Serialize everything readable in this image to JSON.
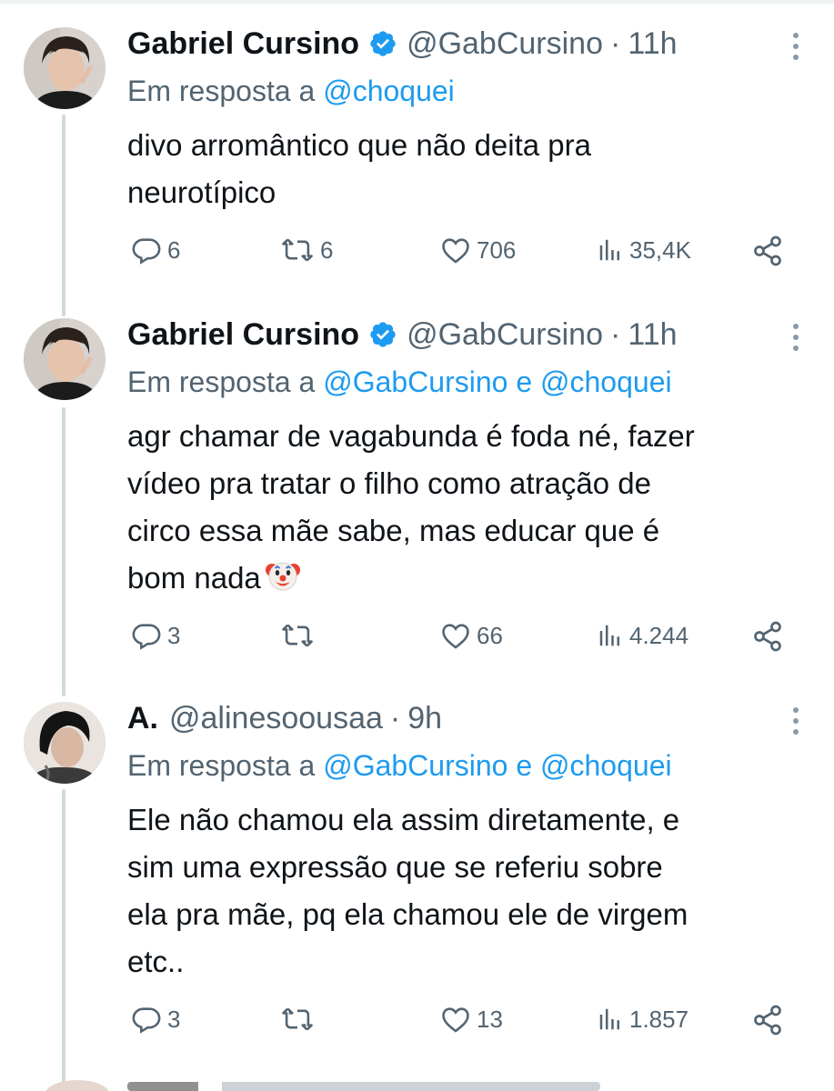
{
  "tweets": [
    {
      "name": "Gabriel Cursino",
      "verified": true,
      "handle": "@GabCursino",
      "separator": "·",
      "time": "11h",
      "reply_prefix": "Em resposta a",
      "reply_mention_1": "@choquei",
      "reply_and": "",
      "reply_mention_2": "",
      "text_lines": [
        "divo arromântico que não deita pra",
        "neurotípico"
      ],
      "stats": {
        "replies": "6",
        "retweets": "6",
        "likes": "706",
        "views": "35,4K"
      }
    },
    {
      "name": "Gabriel Cursino",
      "verified": true,
      "handle": "@GabCursino",
      "separator": "·",
      "time": "11h",
      "reply_prefix": "Em resposta a",
      "reply_mention_1": "@GabCursino",
      "reply_and": "e",
      "reply_mention_2": "@choquei",
      "text_lines": [
        "agr chamar de vagabunda é foda né, fazer",
        "vídeo pra tratar o filho como atração de",
        "circo essa mãe sabe, mas educar que é",
        "bom nada"
      ],
      "emoji": "clown-face",
      "stats": {
        "replies": "3",
        "retweets": "",
        "likes": "66",
        "views": "4.244"
      }
    },
    {
      "name": "A.",
      "verified": false,
      "handle": "@alinesoousaa",
      "separator": "·",
      "time": "9h",
      "reply_prefix": "Em resposta a",
      "reply_mention_1": "@GabCursino",
      "reply_and": "e",
      "reply_mention_2": "@choquei",
      "text_lines": [
        "Ele não chamou ela assim diretamente, e",
        "sim uma expressão que se referiu sobre",
        "ela pra mãe, pq ela chamou ele de virgem",
        "etc.."
      ],
      "stats": {
        "replies": "3",
        "retweets": "",
        "likes": "13",
        "views": "1.857"
      }
    }
  ],
  "icons": {
    "reply": "reply-icon",
    "retweet": "retweet-icon",
    "like": "heart-icon",
    "views": "views-icon",
    "share": "share-icon",
    "verified": "verified-badge-icon",
    "more": "more-options-icon"
  },
  "colors": {
    "text": "#0f1419",
    "secondary": "#536471",
    "link": "#1d9bf0",
    "thread_line": "#cfd9de"
  }
}
